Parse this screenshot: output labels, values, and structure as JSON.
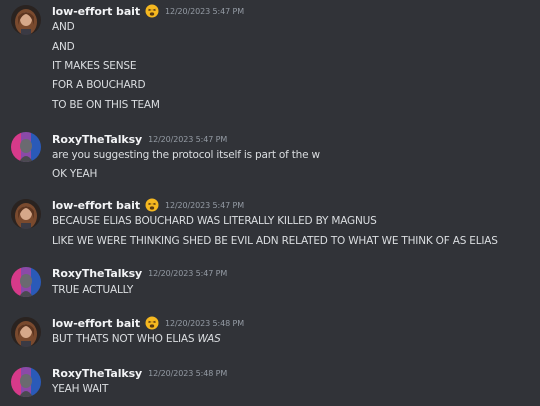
{
  "messages": [
    {
      "username": "low-effort bait",
      "timestamp": "12/20/2023 5:47 PM",
      "avatar": "avatar-low-effort-bait",
      "badge_icon": "tired-face-emoji",
      "lines": [
        "AND",
        "AND",
        "IT MAKES SENSE",
        "FOR A BOUCHARD",
        "TO BE ON THIS TEAM"
      ]
    },
    {
      "username": "RoxyTheTalksy",
      "timestamp": "12/20/2023 5:47 PM",
      "avatar": "avatar-roxythetalksy",
      "lines": [
        "are you suggesting the protocol itself is part of the w",
        "OK YEAH"
      ]
    },
    {
      "username": "low-effort bait",
      "timestamp": "12/20/2023 5:47 PM",
      "avatar": "avatar-low-effort-bait",
      "badge_icon": "tired-face-emoji",
      "lines": [
        "BECAUSE ELIAS BOUCHARD WAS LITERALLY KILLED BY MAGNUS",
        "LIKE WE WERE THINKING SHED BE EVIL ADN RELATED TO WHAT WE THINK OF AS ELIAS"
      ]
    },
    {
      "username": "RoxyTheTalksy",
      "timestamp": "12/20/2023 5:47 PM",
      "avatar": "avatar-roxythetalksy",
      "lines": [
        "TRUE ACTUALLY"
      ]
    },
    {
      "username": "low-effort bait",
      "timestamp": "12/20/2023 5:48 PM",
      "avatar": "avatar-low-effort-bait",
      "badge_icon": "tired-face-emoji",
      "lines": [],
      "line_prefix": "BUT THATS NOT WHO ELIAS ",
      "line_italic": "WAS"
    },
    {
      "username": "RoxyTheTalksy",
      "timestamp": "12/20/2023 5:48 PM",
      "avatar": "avatar-roxythetalksy",
      "lines": [
        "YEAH WAIT"
      ]
    }
  ],
  "colors": {
    "background": "#313338",
    "username": "#f2f3f5",
    "message_text": "#dbdee1",
    "timestamp": "#949ba4"
  }
}
